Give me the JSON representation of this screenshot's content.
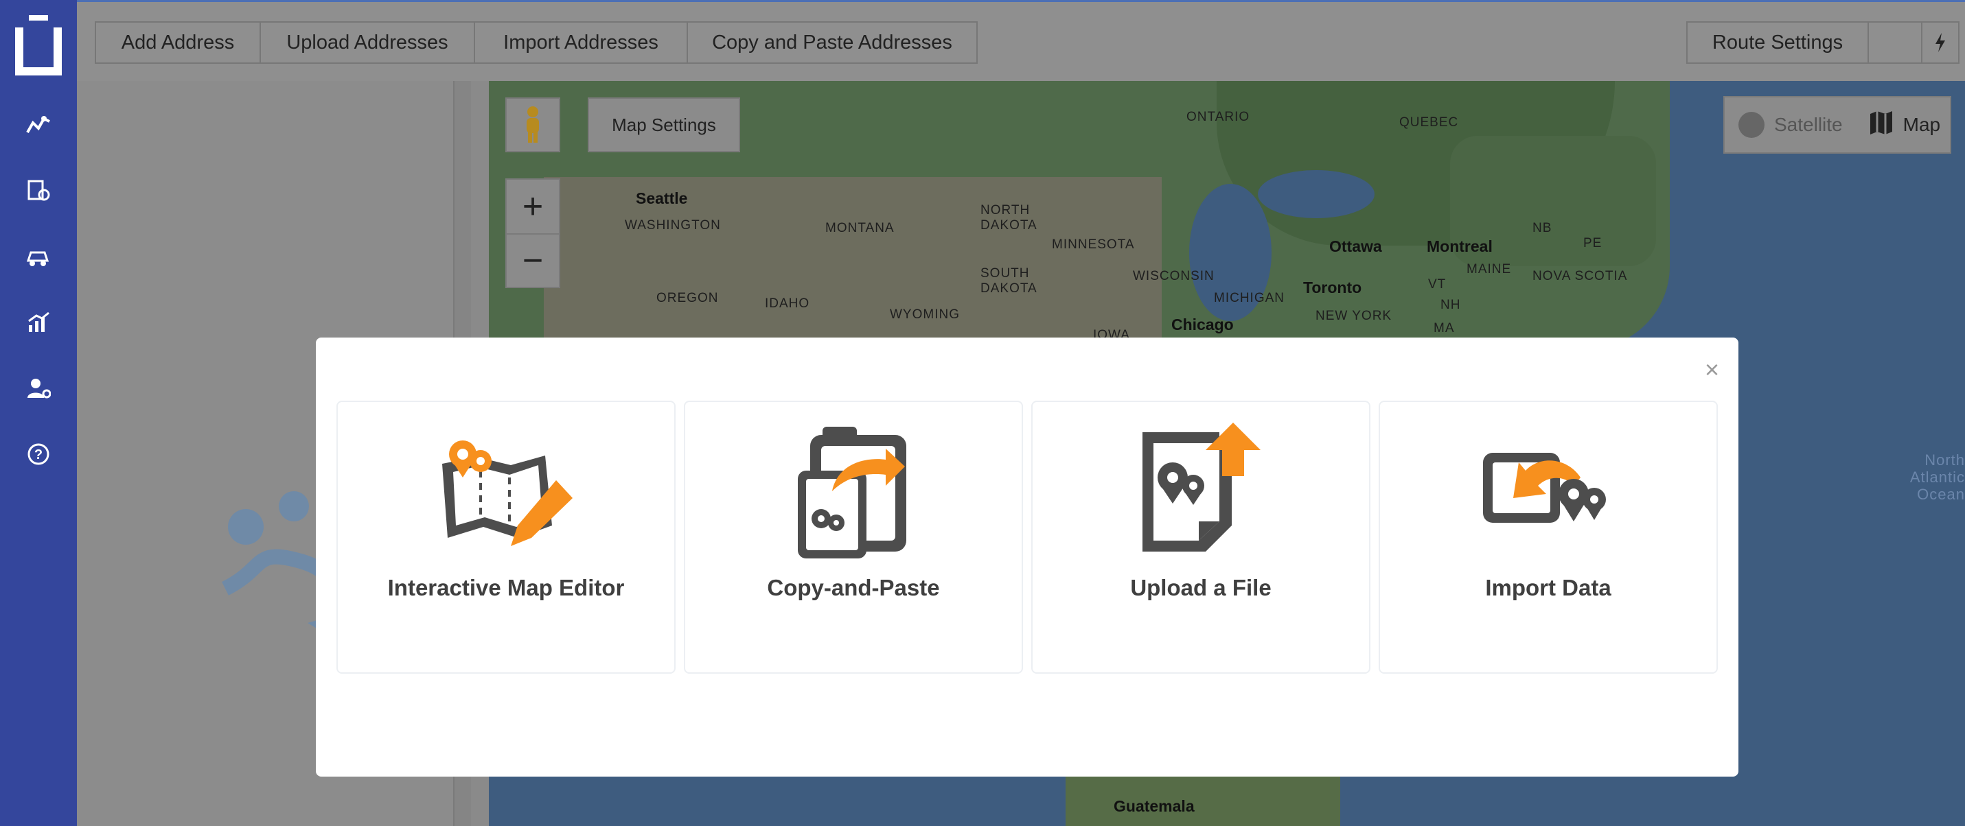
{
  "sidebar": {
    "items": [
      {
        "icon": "routes-icon"
      },
      {
        "icon": "vehicle-location-icon"
      },
      {
        "icon": "driver-icon"
      },
      {
        "icon": "analytics-icon"
      },
      {
        "icon": "user-settings-icon"
      },
      {
        "icon": "help-icon"
      }
    ]
  },
  "toolbar": {
    "add_address": "Add Address",
    "upload_addresses": "Upload Addresses",
    "import_addresses": "Import Addresses",
    "copy_paste_addresses": "Copy and Paste Addresses",
    "route_settings": "Route Settings"
  },
  "map": {
    "settings_label": "Map Settings",
    "zoom_in": "+",
    "zoom_out": "−",
    "type_satellite": "Satellite",
    "type_map": "Map",
    "labels": {
      "ontario": "ONTARIO",
      "quebec": "QUEBEC",
      "seattle": "Seattle",
      "washington": "WASHINGTON",
      "montana": "MONTANA",
      "north_dakota": "NORTH DAKOTA",
      "minnesota": "MINNESOTA",
      "ottawa": "Ottawa",
      "montreal": "Montreal",
      "nb": "NB",
      "pe": "PE",
      "south_dakota": "SOUTH DAKOTA",
      "wisconsin": "WISCONSIN",
      "maine": "MAINE",
      "nova_scotia": "NOVA SCOTIA",
      "oregon": "OREGON",
      "idaho": "IDAHO",
      "wyoming": "WYOMING",
      "michigan": "MICHIGAN",
      "toronto": "Toronto",
      "vt": "VT",
      "nh": "NH",
      "new_york": "NEW YORK",
      "ma": "MA",
      "iowa": "IOWA",
      "chicago": "Chicago",
      "ocean": "North Atlantic Ocean",
      "guatemala": "Guatemala"
    }
  },
  "modal": {
    "close": "×",
    "cards": [
      {
        "label": "Interactive Map Editor",
        "icon": "map-editor-icon"
      },
      {
        "label": "Copy-and-Paste",
        "icon": "clipboard-icon"
      },
      {
        "label": "Upload a File",
        "icon": "file-upload-icon"
      },
      {
        "label": "Import Data",
        "icon": "import-data-icon"
      }
    ]
  },
  "colors": {
    "sidebar": "#34469c",
    "accent": "#f7901e",
    "icon_gray": "#4d4d4d"
  }
}
